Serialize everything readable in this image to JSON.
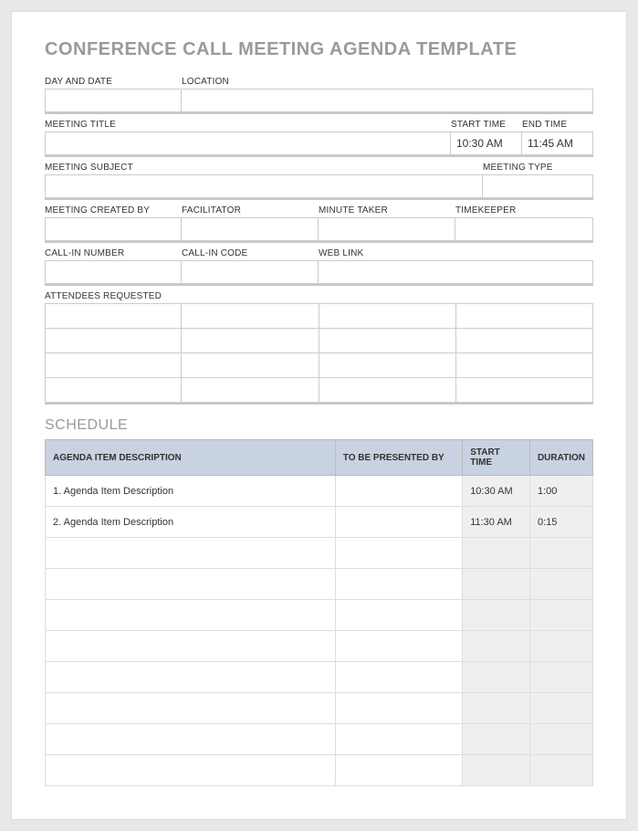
{
  "title": "CONFERENCE CALL MEETING AGENDA TEMPLATE",
  "labels": {
    "day_date": "DAY AND DATE",
    "location": "LOCATION",
    "meeting_title": "MEETING TITLE",
    "start_time": "START TIME",
    "end_time": "END TIME",
    "meeting_subject": "MEETING SUBJECT",
    "meeting_type": "MEETING TYPE",
    "created_by": "MEETING CREATED BY",
    "facilitator": "FACILITATOR",
    "minute_taker": "MINUTE TAKER",
    "timekeeper": "TIMEKEEPER",
    "callin_number": "CALL-IN NUMBER",
    "callin_code": "CALL-IN CODE",
    "web_link": "WEB LINK",
    "attendees": "ATTENDEES REQUESTED"
  },
  "values": {
    "start_time": "10:30 AM",
    "end_time": "11:45 AM"
  },
  "schedule": {
    "heading": "SCHEDULE",
    "headers": {
      "desc": "AGENDA ITEM DESCRIPTION",
      "presented_by": "TO BE PRESENTED BY",
      "start": "START TIME",
      "duration": "DURATION"
    },
    "rows": [
      {
        "desc": "1. Agenda Item Description",
        "presented_by": "",
        "start": "10:30 AM",
        "duration": "1:00"
      },
      {
        "desc": "2. Agenda Item Description",
        "presented_by": "",
        "start": "11:30 AM",
        "duration": "0:15"
      },
      {
        "desc": "",
        "presented_by": "",
        "start": "",
        "duration": ""
      },
      {
        "desc": "",
        "presented_by": "",
        "start": "",
        "duration": ""
      },
      {
        "desc": "",
        "presented_by": "",
        "start": "",
        "duration": ""
      },
      {
        "desc": "",
        "presented_by": "",
        "start": "",
        "duration": ""
      },
      {
        "desc": "",
        "presented_by": "",
        "start": "",
        "duration": ""
      },
      {
        "desc": "",
        "presented_by": "",
        "start": "",
        "duration": ""
      },
      {
        "desc": "",
        "presented_by": "",
        "start": "",
        "duration": ""
      },
      {
        "desc": "",
        "presented_by": "",
        "start": "",
        "duration": ""
      }
    ]
  }
}
